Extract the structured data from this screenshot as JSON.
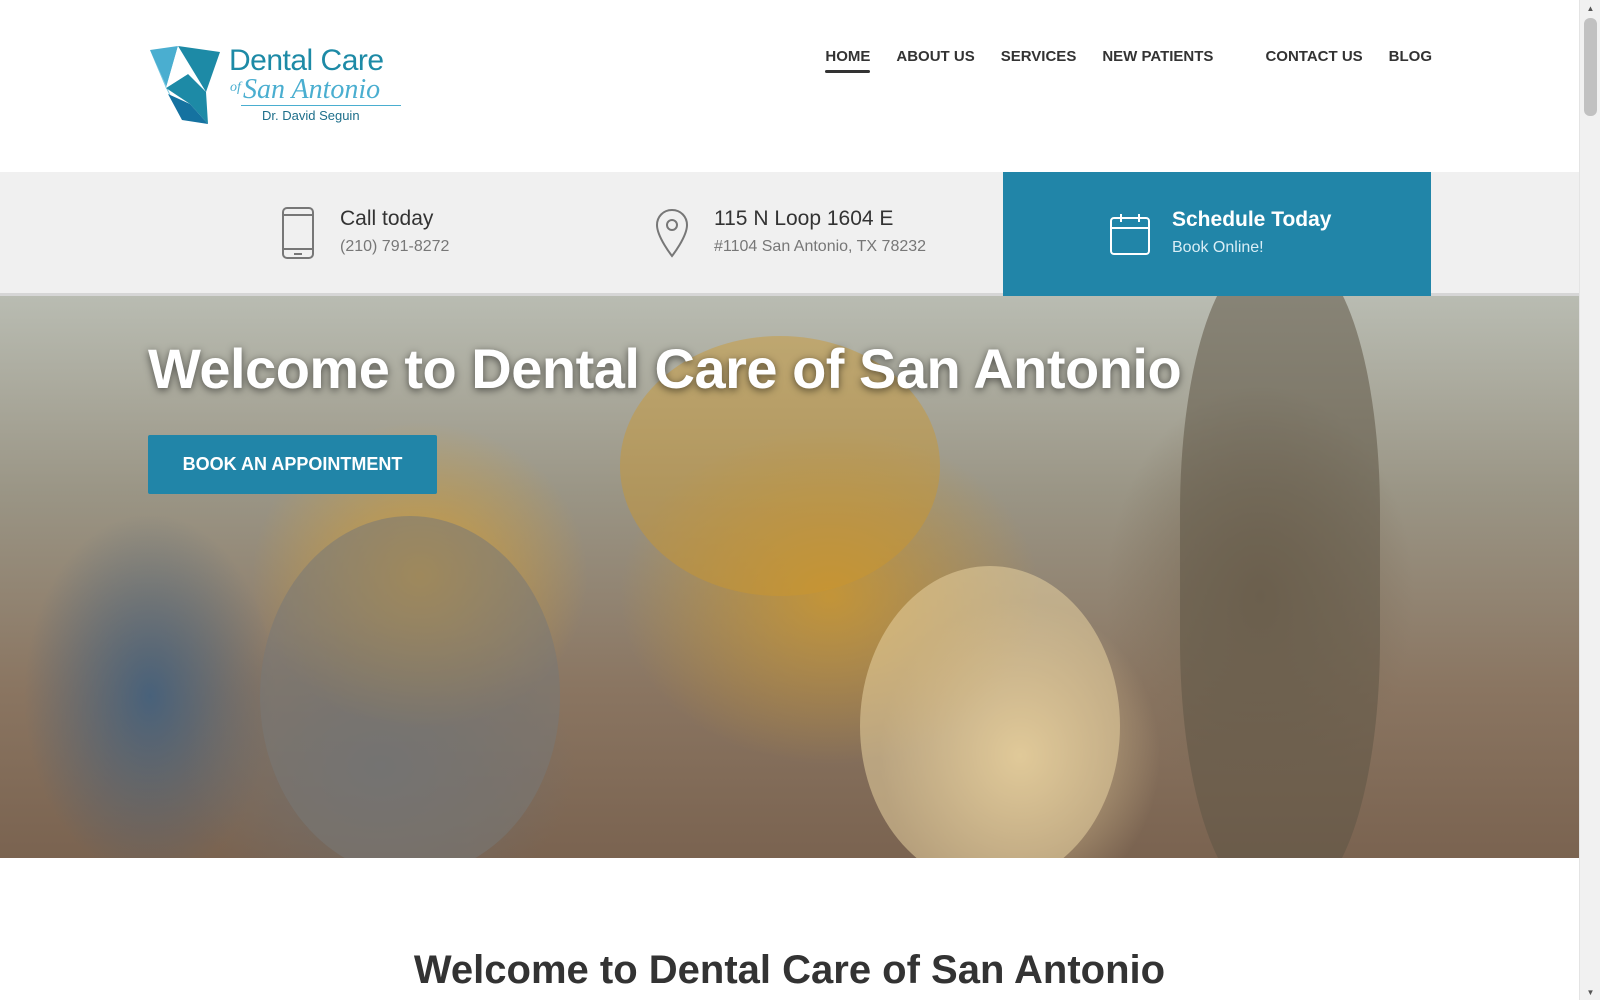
{
  "logo": {
    "line1": "Dental Care",
    "of": "of",
    "line2": "San Antonio",
    "doctor": "Dr. David Seguin"
  },
  "nav": {
    "items": [
      {
        "label": "HOME",
        "active": true
      },
      {
        "label": "ABOUT US"
      },
      {
        "label": "SERVICES"
      },
      {
        "label": "NEW PATIENTS"
      },
      {
        "label": "CONTACT US"
      },
      {
        "label": "BLOG"
      }
    ]
  },
  "infobar": {
    "call": {
      "title": "Call today",
      "sub": "(210) 791-8272",
      "icon": "phone-icon"
    },
    "address": {
      "title": "115 N Loop 1604 E",
      "sub": "#1104 San Antonio, TX 78232",
      "icon": "map-pin-icon"
    },
    "schedule": {
      "title": "Schedule Today",
      "sub": "Book Online!",
      "icon": "calendar-icon"
    }
  },
  "hero": {
    "title": "Welcome to Dental Care of San Antonio",
    "button": "BOOK AN APPOINTMENT"
  },
  "welcome": {
    "heading": "Welcome to Dental Care of San Antonio"
  },
  "colors": {
    "brand": "#2185a8",
    "logo_dark": "#1d8aa6",
    "logo_light": "#4aaed0",
    "infobar_bg": "#f0f0f0"
  }
}
